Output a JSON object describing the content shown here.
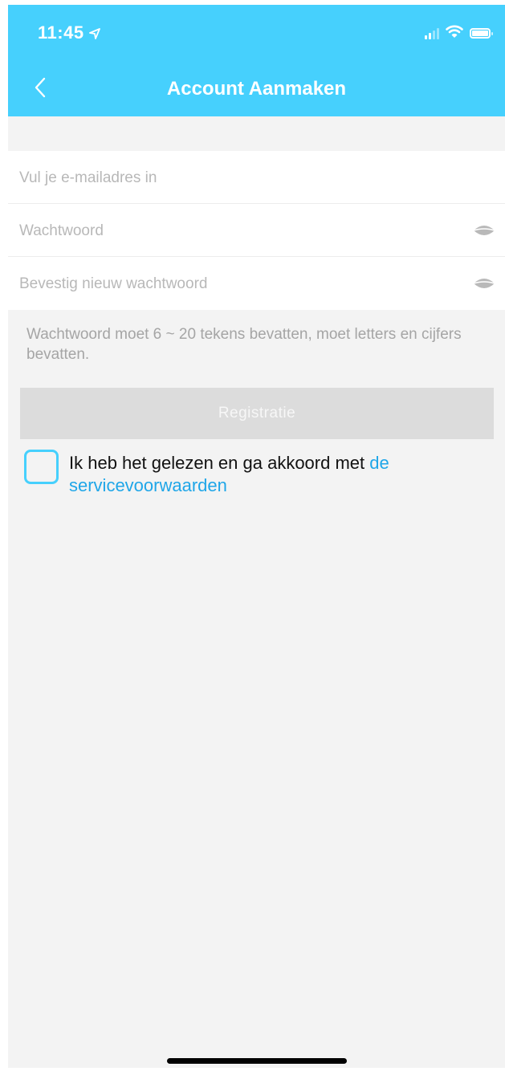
{
  "status_bar": {
    "time": "11:45"
  },
  "header": {
    "title": "Account Aanmaken"
  },
  "form": {
    "email_placeholder": "Vul je e-mailadres in",
    "password_placeholder": "Wachtwoord",
    "confirm_placeholder": "Bevestig nieuw wachtwoord"
  },
  "hint": "Wachtwoord moet 6 ~ 20 tekens bevatten, moet letters en cijfers bevatten.",
  "register_button": "Registratie",
  "agreement": {
    "text": "Ik heb het gelezen en ga akkoord met",
    "link": "de servicevoorwaarden",
    "checked": false
  },
  "colors": {
    "accent": "#46d0fd",
    "link": "#1fa6e8",
    "button_disabled": "#dcdcdc",
    "background": "#f3f3f3"
  }
}
